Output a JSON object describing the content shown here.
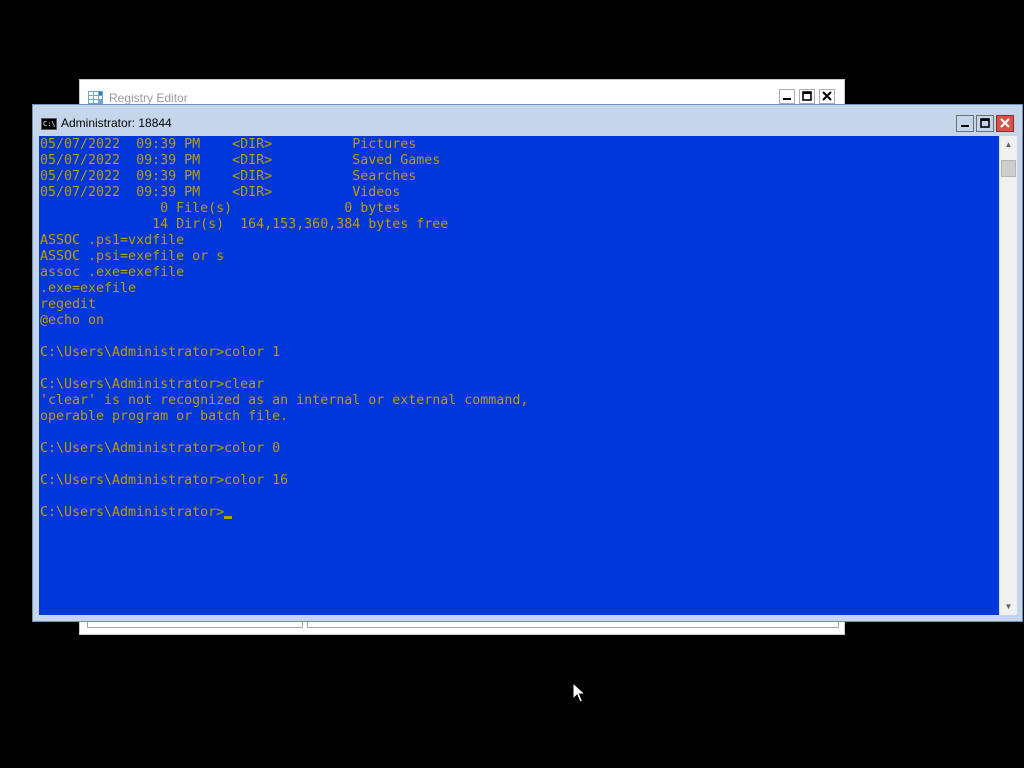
{
  "regedit_window": {
    "title": "Registry Editor",
    "icon": "registry-editor-icon",
    "controls": [
      "minimize",
      "maximize",
      "close"
    ]
  },
  "cmd_window": {
    "title": "Administrator:  18844",
    "icon": "command-prompt-icon",
    "icon_text": "C:\\",
    "controls": [
      "minimize",
      "maximize",
      "close"
    ],
    "colors": {
      "background": "#0037da",
      "text": "#c19c00"
    },
    "lines": [
      "05/07/2022  09:39 PM    <DIR>          Pictures",
      "05/07/2022  09:39 PM    <DIR>          Saved Games",
      "05/07/2022  09:39 PM    <DIR>          Searches",
      "05/07/2022  09:39 PM    <DIR>          Videos",
      "               0 File(s)              0 bytes",
      "              14 Dir(s)  164,153,360,384 bytes free",
      "ASSOC .ps1=vxdfile",
      "ASSOC .psi=exefile or s",
      "assoc .exe=exefile",
      ".exe=exefile",
      "regedit",
      "@echo on",
      "",
      "C:\\Users\\Administrator>color 1",
      "",
      "C:\\Users\\Administrator>clear",
      "'clear' is not recognized as an internal or external command,",
      "operable program or batch file.",
      "",
      "C:\\Users\\Administrator>color 0",
      "",
      "C:\\Users\\Administrator>color 16",
      "",
      "C:\\Users\\Administrator>"
    ]
  }
}
